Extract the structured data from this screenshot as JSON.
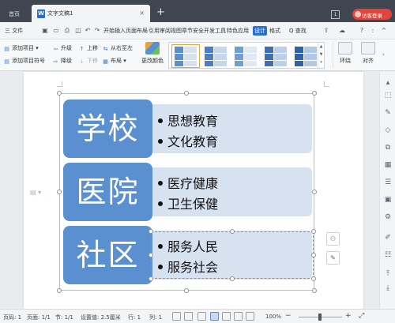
{
  "titlebar": {
    "home_tab": "首页",
    "doc_tab": "文字文稿1",
    "doc_icon": "W",
    "close_glyph": "×",
    "add_glyph": "+",
    "badge": "1",
    "login_label": "访客登录"
  },
  "menubar": {
    "file_label": "三 文件",
    "items": [
      "开始",
      "插入",
      "页面布局",
      "引用",
      "审阅",
      "视图",
      "章节",
      "安全",
      "开发工具",
      "特色应用"
    ],
    "active_tab": "设计",
    "format_tab": "格式",
    "search_label": "Q 查找",
    "right_glyphs": [
      "?",
      ":",
      "^"
    ]
  },
  "ribbon": {
    "add_item": "添加项目",
    "add_bullet": "添加项目符号",
    "promote": "升级",
    "demote": "降级",
    "move_up": "上移",
    "move_down": "下移",
    "right_to_left": "从右至左",
    "layout": "布局",
    "change_color": "更改颜色",
    "wrap": "环绕",
    "align": "对齐"
  },
  "smartart": {
    "rows": [
      {
        "label": "学校",
        "bullets": [
          "思想教育",
          "文化教育"
        ]
      },
      {
        "label": "医院",
        "bullets": [
          "医疗健康",
          "卫生保健"
        ]
      },
      {
        "label": "社区",
        "bullets": [
          "服务人民",
          "服务社会"
        ]
      }
    ]
  },
  "statusbar": {
    "page_num": "页码: 1",
    "page_count": "页面: 1/1",
    "section": "节: 1/1",
    "setting": "设置值: 2.5厘米",
    "row": "行: 1",
    "col": "列: 1",
    "zoom": "100%"
  },
  "colors": {
    "accent": "#2b6ed2",
    "shape_dark": "#5a8fd0",
    "shape_light": "#d7e2f1",
    "login": "#e0443a"
  }
}
